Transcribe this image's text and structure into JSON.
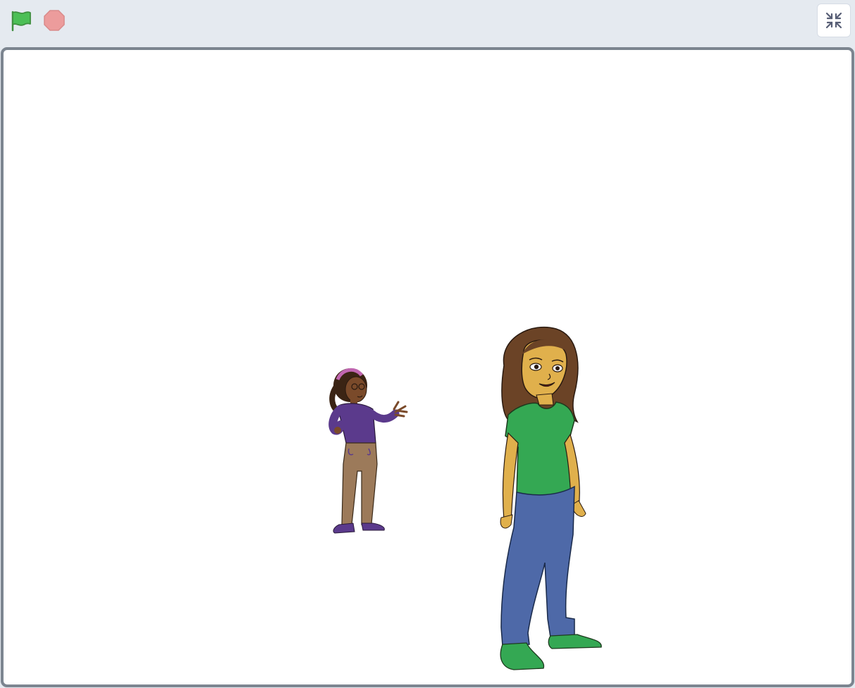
{
  "toolbar": {
    "green_flag": {
      "icon": "green-flag-icon",
      "color": "#4cbf56"
    },
    "stop": {
      "icon": "stop-icon",
      "color": "#ec9c9c"
    },
    "unfullscreen": {
      "icon": "unfullscreen-icon",
      "color": "#575e75"
    }
  },
  "stage": {
    "background": "#ffffff",
    "border_color": "#7c8590",
    "sprites": [
      {
        "name": "girl-purple-shirt",
        "shirt_color": "#5b3a8c",
        "pants_color": "#9c7a5a"
      },
      {
        "name": "girl-green-shirt",
        "shirt_color": "#34a853",
        "pants_color": "#4e69a8"
      }
    ]
  }
}
